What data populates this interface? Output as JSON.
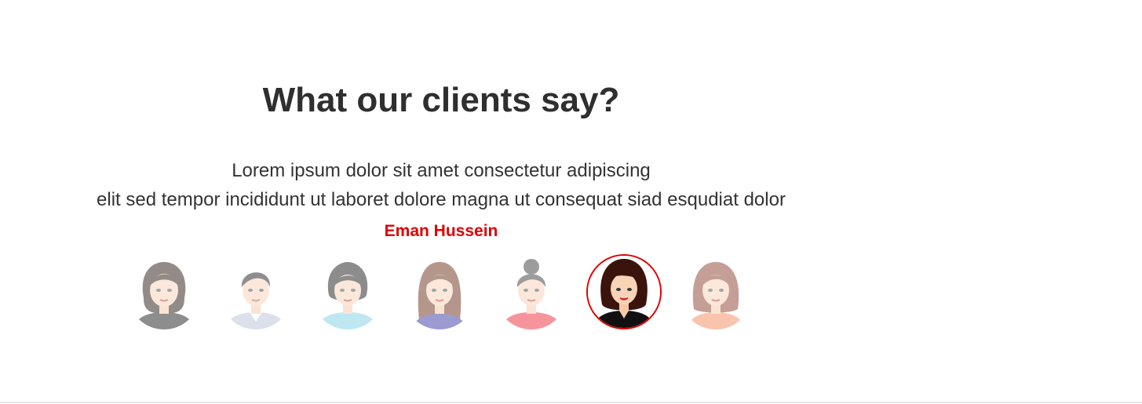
{
  "testimonials": {
    "title": "What our clients say?",
    "quote_line1": "Lorem ipsum dolor sit amet consectetur adipiscing",
    "quote_line2": "elit sed tempor incididunt ut laboret dolore magna ut consequat siad esqudiat dolor",
    "client_name": "Eman Hussein",
    "client_name_color": "#e00000",
    "active_index": 5,
    "avatars": [
      {
        "icon": "woman-bob-hair-avatar-icon",
        "hair": "#2a1a12",
        "top": "#1d1d1d",
        "state": "inactive"
      },
      {
        "icon": "man-short-hair-avatar-icon",
        "hair": "#1f1f1f",
        "top": "#b9c2d6",
        "state": "inactive"
      },
      {
        "icon": "woman-short-hair-avatar-icon",
        "hair": "#1c1c1c",
        "top": "#7fd0e6",
        "state": "inactive"
      },
      {
        "icon": "woman-long-hair-avatar-icon",
        "hair": "#6b2f1a",
        "top": "#3a3aa6",
        "state": "inactive"
      },
      {
        "icon": "woman-bun-hair-avatar-icon",
        "hair": "#3b3b3b",
        "top": "#ef2c3c",
        "state": "inactive"
      },
      {
        "icon": "woman-dark-bob-avatar-icon",
        "hair": "#3a140c",
        "top": "#111111",
        "state": "active"
      },
      {
        "icon": "woman-auburn-hair-avatar-icon",
        "hair": "#8c3f2f",
        "top": "#f58a5e",
        "state": "inactive"
      }
    ]
  }
}
